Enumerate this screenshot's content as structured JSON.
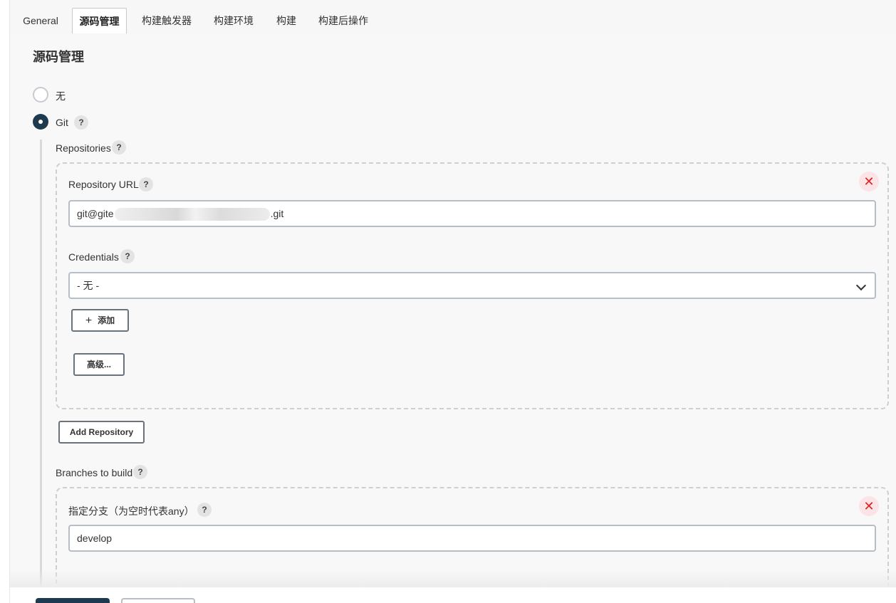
{
  "tabs": [
    {
      "label": "General"
    },
    {
      "label": "源码管理"
    },
    {
      "label": "构建触发器"
    },
    {
      "label": "构建环境"
    },
    {
      "label": "构建"
    },
    {
      "label": "构建后操作"
    }
  ],
  "section": {
    "title": "源码管理",
    "option_none": "无",
    "option_git": "Git",
    "help_glyph": "?",
    "close_glyph": "✕",
    "repositories_label": "Repositories",
    "repository_url_label": "Repository URL",
    "repository_url_prefix": "git@gite",
    "repository_url_suffix": ".git",
    "credentials_label": "Credentials",
    "credentials_selected": "- 无 -",
    "add_button": "添加",
    "advanced_button": "高级...",
    "add_repository_button": "Add Repository",
    "branches_label": "Branches to build",
    "branch_specifier_label": "指定分支（为空时代表any）",
    "branch_specifier_value": "develop"
  },
  "colors": {
    "accent": "#1d3a4f",
    "danger": "#dd2222"
  }
}
